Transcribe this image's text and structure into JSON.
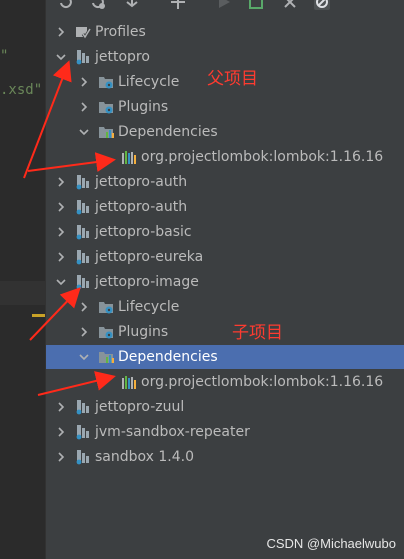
{
  "editor": {
    "line1": "\"",
    "line2": ".xsd\""
  },
  "tree": {
    "items": [
      {
        "label": "Profiles",
        "icon": "profiles-icon",
        "arrow": "right",
        "level": 0
      },
      {
        "label": "jettopro",
        "icon": "maven-module-icon",
        "arrow": "down",
        "level": 0
      },
      {
        "label": "Lifecycle",
        "icon": "folder-gear-icon",
        "arrow": "right",
        "level": 1
      },
      {
        "label": "Plugins",
        "icon": "folder-gear-icon",
        "arrow": "right",
        "level": 1
      },
      {
        "label": "Dependencies",
        "icon": "folder-bars-icon",
        "arrow": "down",
        "level": 1
      },
      {
        "label": "org.projectlombok:lombok:1.16.16",
        "icon": "library-bars-icon",
        "arrow": "none",
        "level": 2
      },
      {
        "label": "jettopro-auth",
        "icon": "maven-module-icon",
        "arrow": "right",
        "level": 0
      },
      {
        "label": "jettopro-auth",
        "icon": "maven-module-icon",
        "arrow": "right",
        "level": 0
      },
      {
        "label": "jettopro-basic",
        "icon": "maven-module-icon",
        "arrow": "right",
        "level": 0
      },
      {
        "label": "jettopro-eureka",
        "icon": "maven-module-icon",
        "arrow": "right",
        "level": 0
      },
      {
        "label": "jettopro-image",
        "icon": "maven-module-icon",
        "arrow": "down",
        "level": 0
      },
      {
        "label": "Lifecycle",
        "icon": "folder-gear-icon",
        "arrow": "right",
        "level": 1
      },
      {
        "label": "Plugins",
        "icon": "folder-gear-icon",
        "arrow": "right",
        "level": 1
      },
      {
        "label": "Dependencies",
        "icon": "folder-bars-icon",
        "arrow": "down",
        "level": 1,
        "selected": true
      },
      {
        "label": "org.projectlombok:lombok:1.16.16",
        "icon": "library-bars-icon",
        "arrow": "none",
        "level": 2
      },
      {
        "label": "jettopro-zuul",
        "icon": "maven-module-icon",
        "arrow": "right",
        "level": 0
      },
      {
        "label": "jvm-sandbox-repeater",
        "icon": "maven-module-icon",
        "arrow": "right",
        "level": 0
      },
      {
        "label": "sandbox 1.4.0",
        "icon": "maven-module-icon",
        "arrow": "right",
        "level": 0
      }
    ]
  },
  "annotations": {
    "parent": "父项目",
    "child": "子项目"
  },
  "watermark": "CSDN @Michaelwubo",
  "colors": {
    "accent_selected": "#4b6eaf",
    "annotation": "#ff3b30",
    "background": "#3c3f41"
  },
  "toolbar": {
    "icons": [
      "refresh-icon",
      "reimport-icon",
      "download-icon",
      "add-icon",
      "run-icon",
      "execute-icon",
      "toggle-offline-icon",
      "skip-tests-icon"
    ]
  }
}
